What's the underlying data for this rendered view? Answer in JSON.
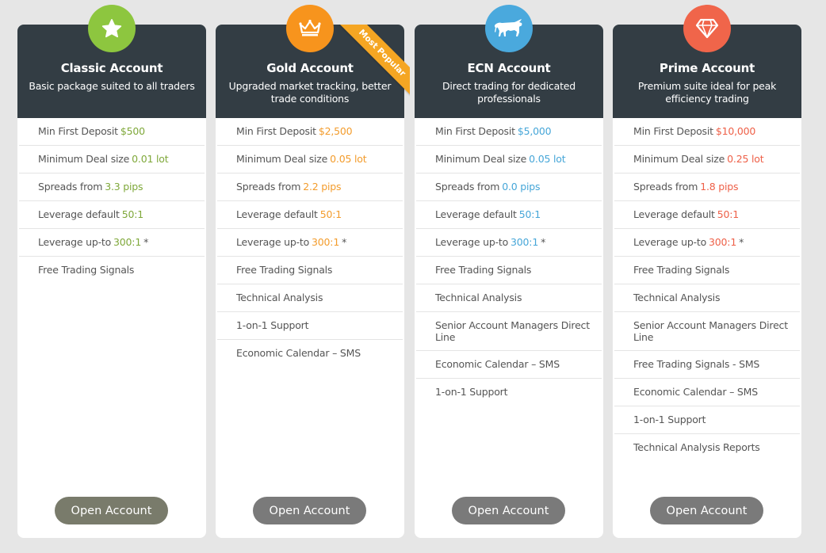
{
  "plans": [
    {
      "title": "Classic Account",
      "subtitle": "Basic package suited to all traders",
      "icon": "star-icon",
      "icon_color": "#8dc63f",
      "accent": "#7fa83a",
      "button_color": "#797b6b",
      "features": [
        {
          "label": "Min First Deposit",
          "value": "$500"
        },
        {
          "label": "Minimum Deal size",
          "value": "0.01 lot"
        },
        {
          "label": "Spreads from",
          "value": "3.3 pips"
        },
        {
          "label": "Leverage default",
          "value": "50:1"
        },
        {
          "label": "Leverage up-to",
          "value": "300:1",
          "suffix": "*"
        },
        {
          "label": "Free Trading Signals"
        }
      ],
      "button_label": "Open Account"
    },
    {
      "title": "Gold Account",
      "subtitle": "Upgraded market tracking, better trade conditions",
      "icon": "crown-icon",
      "icon_color": "#f7941d",
      "accent": "#f39c2c",
      "button_color": "#7a7a7a",
      "ribbon": "Most Popular",
      "features": [
        {
          "label": "Min First Deposit",
          "value": "$2,500"
        },
        {
          "label": "Minimum Deal size",
          "value": "0.05 lot"
        },
        {
          "label": "Spreads from",
          "value": "2.2 pips"
        },
        {
          "label": "Leverage default",
          "value": "50:1"
        },
        {
          "label": "Leverage up-to",
          "value": "300:1",
          "suffix": "*"
        },
        {
          "label": "Free Trading Signals"
        },
        {
          "label": "Technical Analysis"
        },
        {
          "label": "1-on-1 Support"
        },
        {
          "label": "Economic Calendar – SMS"
        }
      ],
      "button_label": "Open Account"
    },
    {
      "title": "ECN Account",
      "subtitle": "Direct trading for dedicated professionals",
      "icon": "bull-icon",
      "icon_color": "#4aa9dd",
      "accent": "#46a6d8",
      "button_color": "#7a7a7a",
      "features": [
        {
          "label": "Min First Deposit",
          "value": "$5,000"
        },
        {
          "label": "Minimum Deal size",
          "value": "0.05 lot"
        },
        {
          "label": "Spreads from",
          "value": "0.0 pips"
        },
        {
          "label": "Leverage default",
          "value": "50:1"
        },
        {
          "label": "Leverage up-to",
          "value": "300:1",
          "suffix": "*"
        },
        {
          "label": "Free Trading Signals"
        },
        {
          "label": "Technical Analysis"
        },
        {
          "label": "Senior Account Managers Direct Line"
        },
        {
          "label": "Economic Calendar – SMS"
        },
        {
          "label": "1-on-1 Support"
        }
      ],
      "button_label": "Open Account"
    },
    {
      "title": "Prime Account",
      "subtitle": "Premium suite ideal for peak efficiency trading",
      "icon": "diamond-icon",
      "icon_color": "#f0654a",
      "accent": "#ee6048",
      "button_color": "#7a7a7a",
      "features": [
        {
          "label": "Min First Deposit",
          "value": "$10,000"
        },
        {
          "label": "Minimum Deal size",
          "value": "0.25 lot"
        },
        {
          "label": "Spreads from",
          "value": "1.8 pips"
        },
        {
          "label": "Leverage default",
          "value": "50:1"
        },
        {
          "label": "Leverage up-to",
          "value": "300:1",
          "suffix": "*"
        },
        {
          "label": "Free Trading Signals"
        },
        {
          "label": "Technical Analysis"
        },
        {
          "label": "Senior Account Managers Direct Line"
        },
        {
          "label": "Free Trading Signals - SMS"
        },
        {
          "label": "Economic Calendar – SMS"
        },
        {
          "label": "1-on-1 Support"
        },
        {
          "label": "Technical Analysis Reports"
        }
      ],
      "button_label": "Open Account"
    }
  ]
}
